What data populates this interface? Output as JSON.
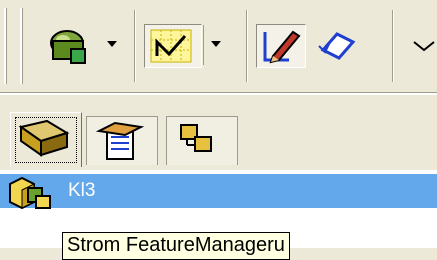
{
  "toolbar": {
    "buttons": [
      {
        "icon": "part-color-icon",
        "dropdown": true,
        "pressed": false
      },
      {
        "icon": "sketch-grid-icon",
        "dropdown": true,
        "pressed": true
      },
      {
        "icon": "edit-sketch-icon",
        "dropdown": false,
        "pressed": true
      },
      {
        "icon": "rotate-view-icon",
        "dropdown": false,
        "pressed": false
      }
    ]
  },
  "panel_tabs": [
    {
      "icon": "feature-manager-icon",
      "active": true
    },
    {
      "icon": "property-manager-icon",
      "active": false
    },
    {
      "icon": "configuration-manager-icon",
      "active": false
    }
  ],
  "tree": {
    "root_label": "Kl3"
  },
  "tooltip": {
    "text": "Strom FeatureManageru"
  },
  "colors": {
    "selection": "#62a8ea",
    "tooltip_bg": "#ffffe1",
    "window_bg": "#ece9d8"
  }
}
